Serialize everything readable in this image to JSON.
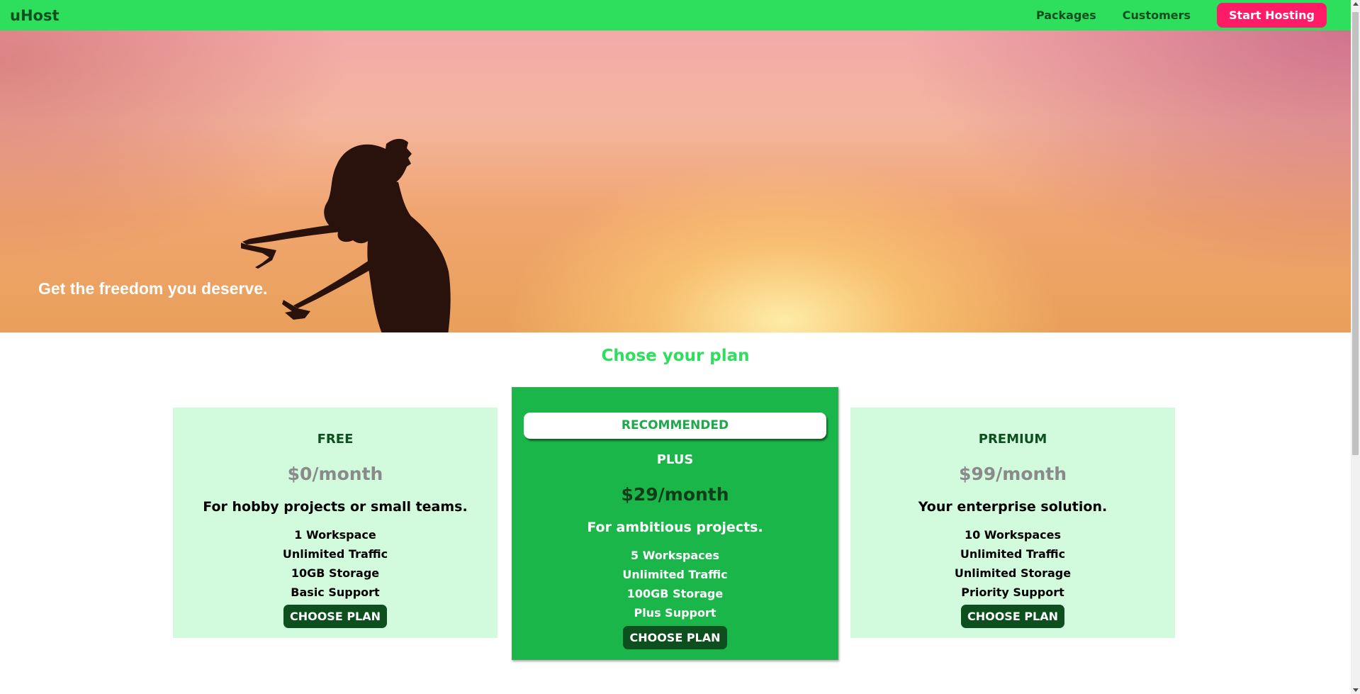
{
  "header": {
    "brand": "uHost",
    "nav": [
      "Packages",
      "Customers"
    ],
    "cta": "Start Hosting"
  },
  "hero": {
    "tagline": "Get the freedom you deserve."
  },
  "plans_section": {
    "title": "Chose your plan",
    "plans": [
      {
        "name": "FREE",
        "price": "$0/month",
        "description": "For hobby projects or small teams.",
        "features": [
          "1 Workspace",
          "Unlimited Traffic",
          "10GB Storage",
          "Basic Support"
        ],
        "button": "CHOOSE PLAN"
      },
      {
        "badge": "RECOMMENDED",
        "name": "PLUS",
        "price": "$29/month",
        "description": "For ambitious projects.",
        "features": [
          "5 Workspaces",
          "Unlimited Traffic",
          "100GB Storage",
          "Plus Support"
        ],
        "button": "CHOOSE PLAN"
      },
      {
        "name": "PREMIUM",
        "price": "$99/month",
        "description": "Your enterprise solution.",
        "features": [
          "10 Workspaces",
          "Unlimited Traffic",
          "Unlimited Storage",
          "Priority Support"
        ],
        "button": "CHOOSE PLAN"
      }
    ]
  },
  "colors": {
    "header_bg": "#2ddf5c",
    "brand_text": "#0e4f1f",
    "cta_bg": "#ff1b68",
    "plan_bg": "#d2fadd",
    "recommended_bg": "#1bb64a",
    "button_bg": "#0e4f1f"
  }
}
